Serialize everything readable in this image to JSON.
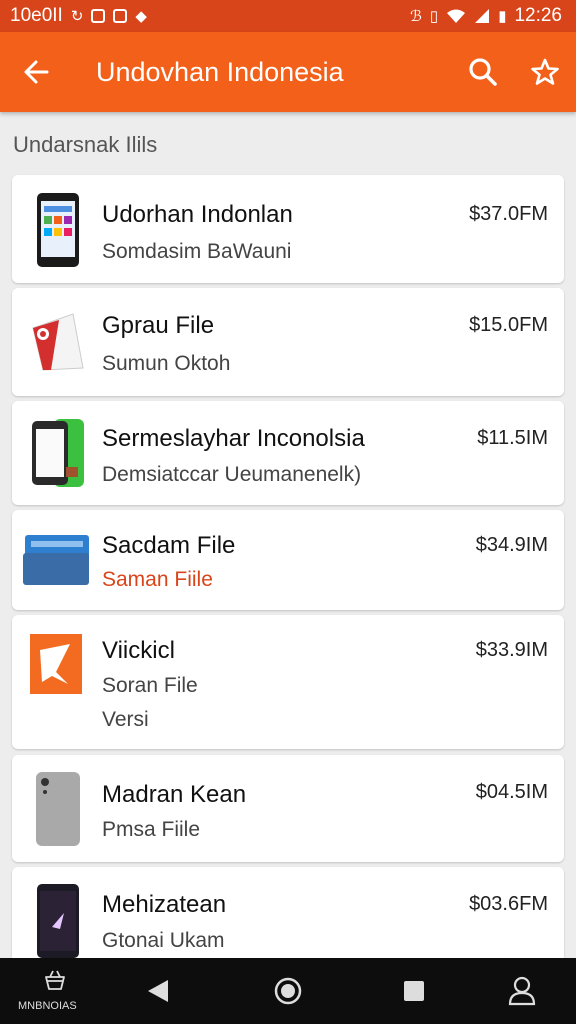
{
  "status_bar": {
    "left_text": "10e0II",
    "time": "12:26"
  },
  "app_bar": {
    "title": "Undovhan Indonesia",
    "icons": [
      "back-arrow-icon",
      "search-icon",
      "star-icon"
    ]
  },
  "section_label": "Undarsnak Ilils",
  "items": [
    {
      "title": "Udorhan Indonlan",
      "subtitle": "Somdasim BaWauni",
      "subtitle2": "",
      "price": "$37.0FM",
      "subtitle_color": "#444444"
    },
    {
      "title": "Gprau File",
      "subtitle": "Sumun Oktoh",
      "subtitle2": "",
      "price": "$15.0FM",
      "subtitle_color": "#444444"
    },
    {
      "title": "Sermeslayhar Inconolsia",
      "subtitle": "Demsiatccar Ueumanenelk)",
      "subtitle2": "",
      "price": "$11.5IM",
      "subtitle_color": "#444444"
    },
    {
      "title": "Sacdam File",
      "subtitle": "Saman Fiile",
      "subtitle2": "",
      "price": "$34.9IM",
      "subtitle_color": "#d9451a"
    },
    {
      "title": "Viickicl",
      "subtitle": "Soran File",
      "subtitle2": "Versi",
      "price": "$33.9IM",
      "subtitle_color": "#444444"
    },
    {
      "title": "Madran Kean",
      "subtitle": "Pmsa Fiile",
      "subtitle2": "",
      "price": "$04.5IM",
      "subtitle_color": "#444444"
    },
    {
      "title": "Mehizatean",
      "subtitle": "Gtonai Ukam",
      "subtitle2": "",
      "price": "$03.6FM",
      "subtitle_color": "#444444"
    }
  ],
  "nav_bar": {
    "label": "MNBNOIAS"
  }
}
